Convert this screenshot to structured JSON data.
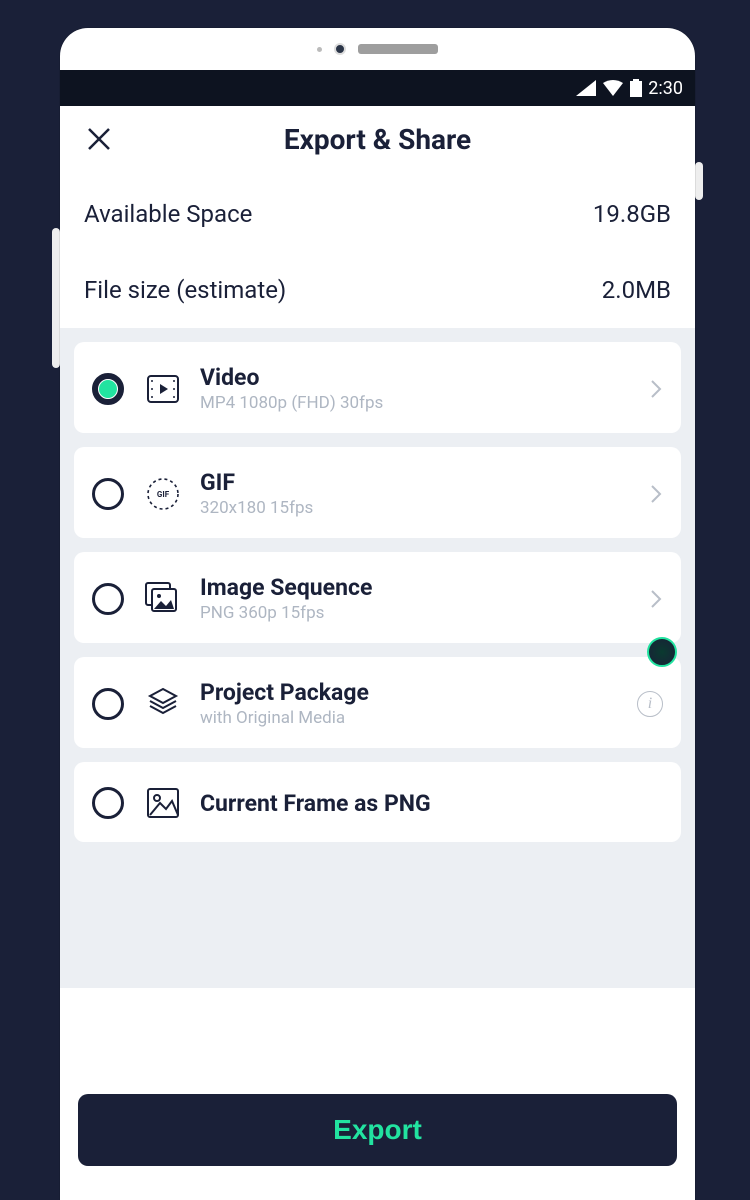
{
  "status": {
    "time": "2:30"
  },
  "header": {
    "title": "Export & Share"
  },
  "info": {
    "space_label": "Available Space",
    "space_value": "19.8GB",
    "size_label": "File size (estimate)",
    "size_value": "2.0MB"
  },
  "options": {
    "video": {
      "title": "Video",
      "sub": "MP4 1080p (FHD) 30fps"
    },
    "gif": {
      "title": "GIF",
      "sub": "320x180 15fps",
      "iconText": "GIF"
    },
    "imgseq": {
      "title": "Image Sequence",
      "sub": "PNG 360p 15fps"
    },
    "package": {
      "title": "Project Package",
      "sub": "with Original Media"
    },
    "frame": {
      "title": "Current Frame as PNG"
    }
  },
  "footer": {
    "export_label": "Export"
  }
}
